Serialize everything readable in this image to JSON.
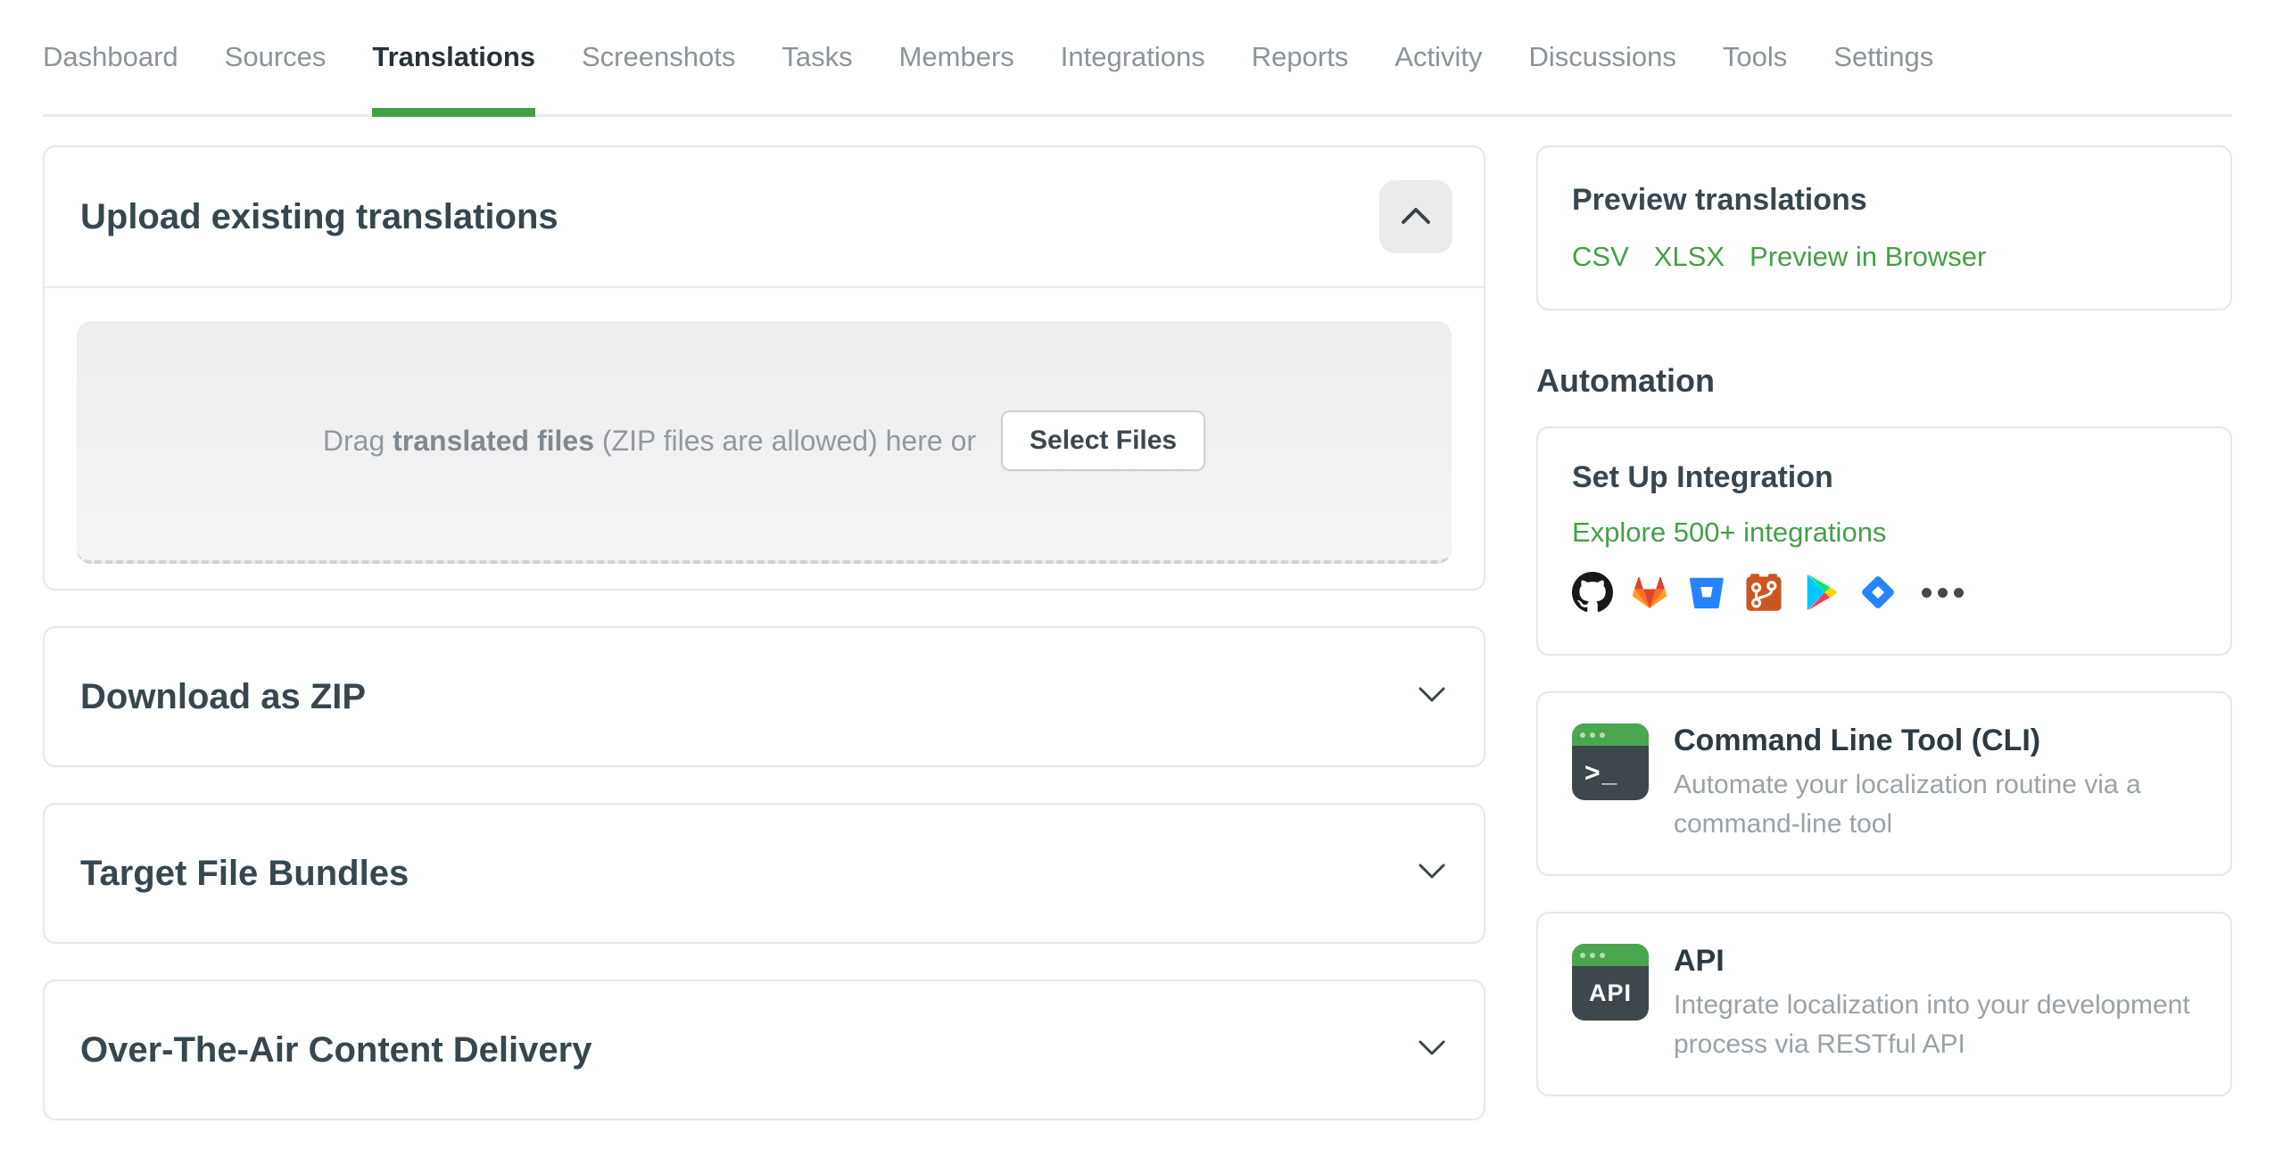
{
  "nav": {
    "tabs": [
      {
        "label": "Dashboard",
        "active": false
      },
      {
        "label": "Sources",
        "active": false
      },
      {
        "label": "Translations",
        "active": true
      },
      {
        "label": "Screenshots",
        "active": false
      },
      {
        "label": "Tasks",
        "active": false
      },
      {
        "label": "Members",
        "active": false
      },
      {
        "label": "Integrations",
        "active": false
      },
      {
        "label": "Reports",
        "active": false
      },
      {
        "label": "Activity",
        "active": false
      },
      {
        "label": "Discussions",
        "active": false
      },
      {
        "label": "Tools",
        "active": false
      },
      {
        "label": "Settings",
        "active": false
      }
    ]
  },
  "main": {
    "upload_card": {
      "title": "Upload existing translations"
    },
    "dropzone": {
      "drag_prefix": "Drag ",
      "drag_bold": "translated files",
      "drag_suffix": " (ZIP files are allowed) here or",
      "select_files_label": "Select Files"
    },
    "download_zip_card": {
      "title": "Download as ZIP"
    },
    "target_bundles_card": {
      "title": "Target File Bundles"
    },
    "ota_card": {
      "title": "Over-The-Air Content Delivery"
    }
  },
  "sidebar": {
    "preview_card": {
      "title": "Preview translations",
      "links": [
        {
          "label": "CSV"
        },
        {
          "label": "XLSX"
        },
        {
          "label": "Preview in Browser"
        }
      ]
    },
    "automation_heading": "Automation",
    "integration_card": {
      "title": "Set Up Integration",
      "explore_link": "Explore 500+ integrations",
      "icons": [
        "github",
        "gitlab",
        "bitbucket",
        "git",
        "google-play",
        "jira",
        "more"
      ]
    },
    "cli_card": {
      "title": "Command Line Tool (CLI)",
      "description": "Automate your localization routine via a command-line tool",
      "icon_text": ">_"
    },
    "api_card": {
      "title": "API",
      "description": "Integrate localization into your development process via RESTful API",
      "icon_text": "API"
    }
  },
  "colors": {
    "accent_green": "#43a047",
    "title_dark": "#37474f",
    "tab_inactive": "#8b9399",
    "text_gray": "#99a2a8",
    "card_border": "#e7e7e7",
    "dropzone_bg": "#f0f0f1"
  }
}
